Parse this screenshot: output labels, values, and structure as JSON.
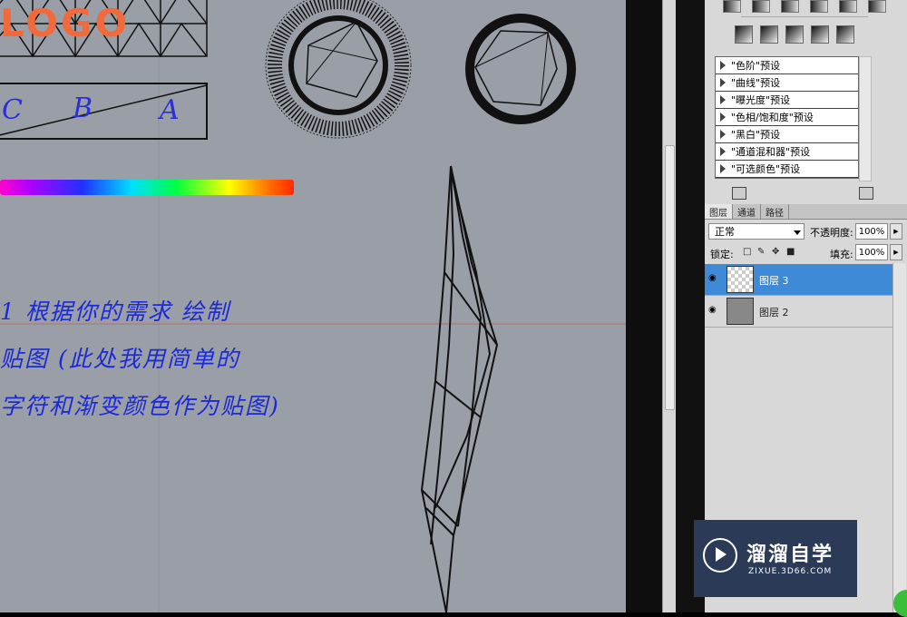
{
  "canvas": {
    "logo_text": "LOGO",
    "letter_box_letters": [
      "C",
      "B",
      "A"
    ],
    "handwritten_lines": [
      "1 根据你的需求 绘制",
      "贴图 (此处我用简单的",
      "字符和渐变颜色作为贴图)"
    ]
  },
  "presets": {
    "items": [
      "\"色阶\"预设",
      "\"曲线\"预设",
      "\"曝光度\"预设",
      "\"色相/饱和度\"预设",
      "\"黑白\"预设",
      "\"通道混和器\"预设",
      "\"可选颜色\"预设"
    ]
  },
  "layers_panel": {
    "tabs": [
      "图层",
      "通道",
      "路径"
    ],
    "blend_mode": "正常",
    "opacity_label": "不透明度:",
    "opacity_value": "100%",
    "lock_label": "锁定:",
    "fill_label": "填充:",
    "fill_value": "100%",
    "layers": [
      {
        "name": "图层 3",
        "selected": true
      },
      {
        "name": "图层 2",
        "selected": false
      }
    ]
  },
  "watermark": {
    "title": "溜溜自学",
    "subtitle": "ZIXUE.3D66.COM"
  },
  "colors": {
    "canvas_bg": "#9a9ea6",
    "logo_orange": "#f06a3b",
    "handwriting_blue": "#1b2ad6",
    "selected_layer": "#3e8ad6",
    "watermark_bg": "#2b3a57"
  }
}
